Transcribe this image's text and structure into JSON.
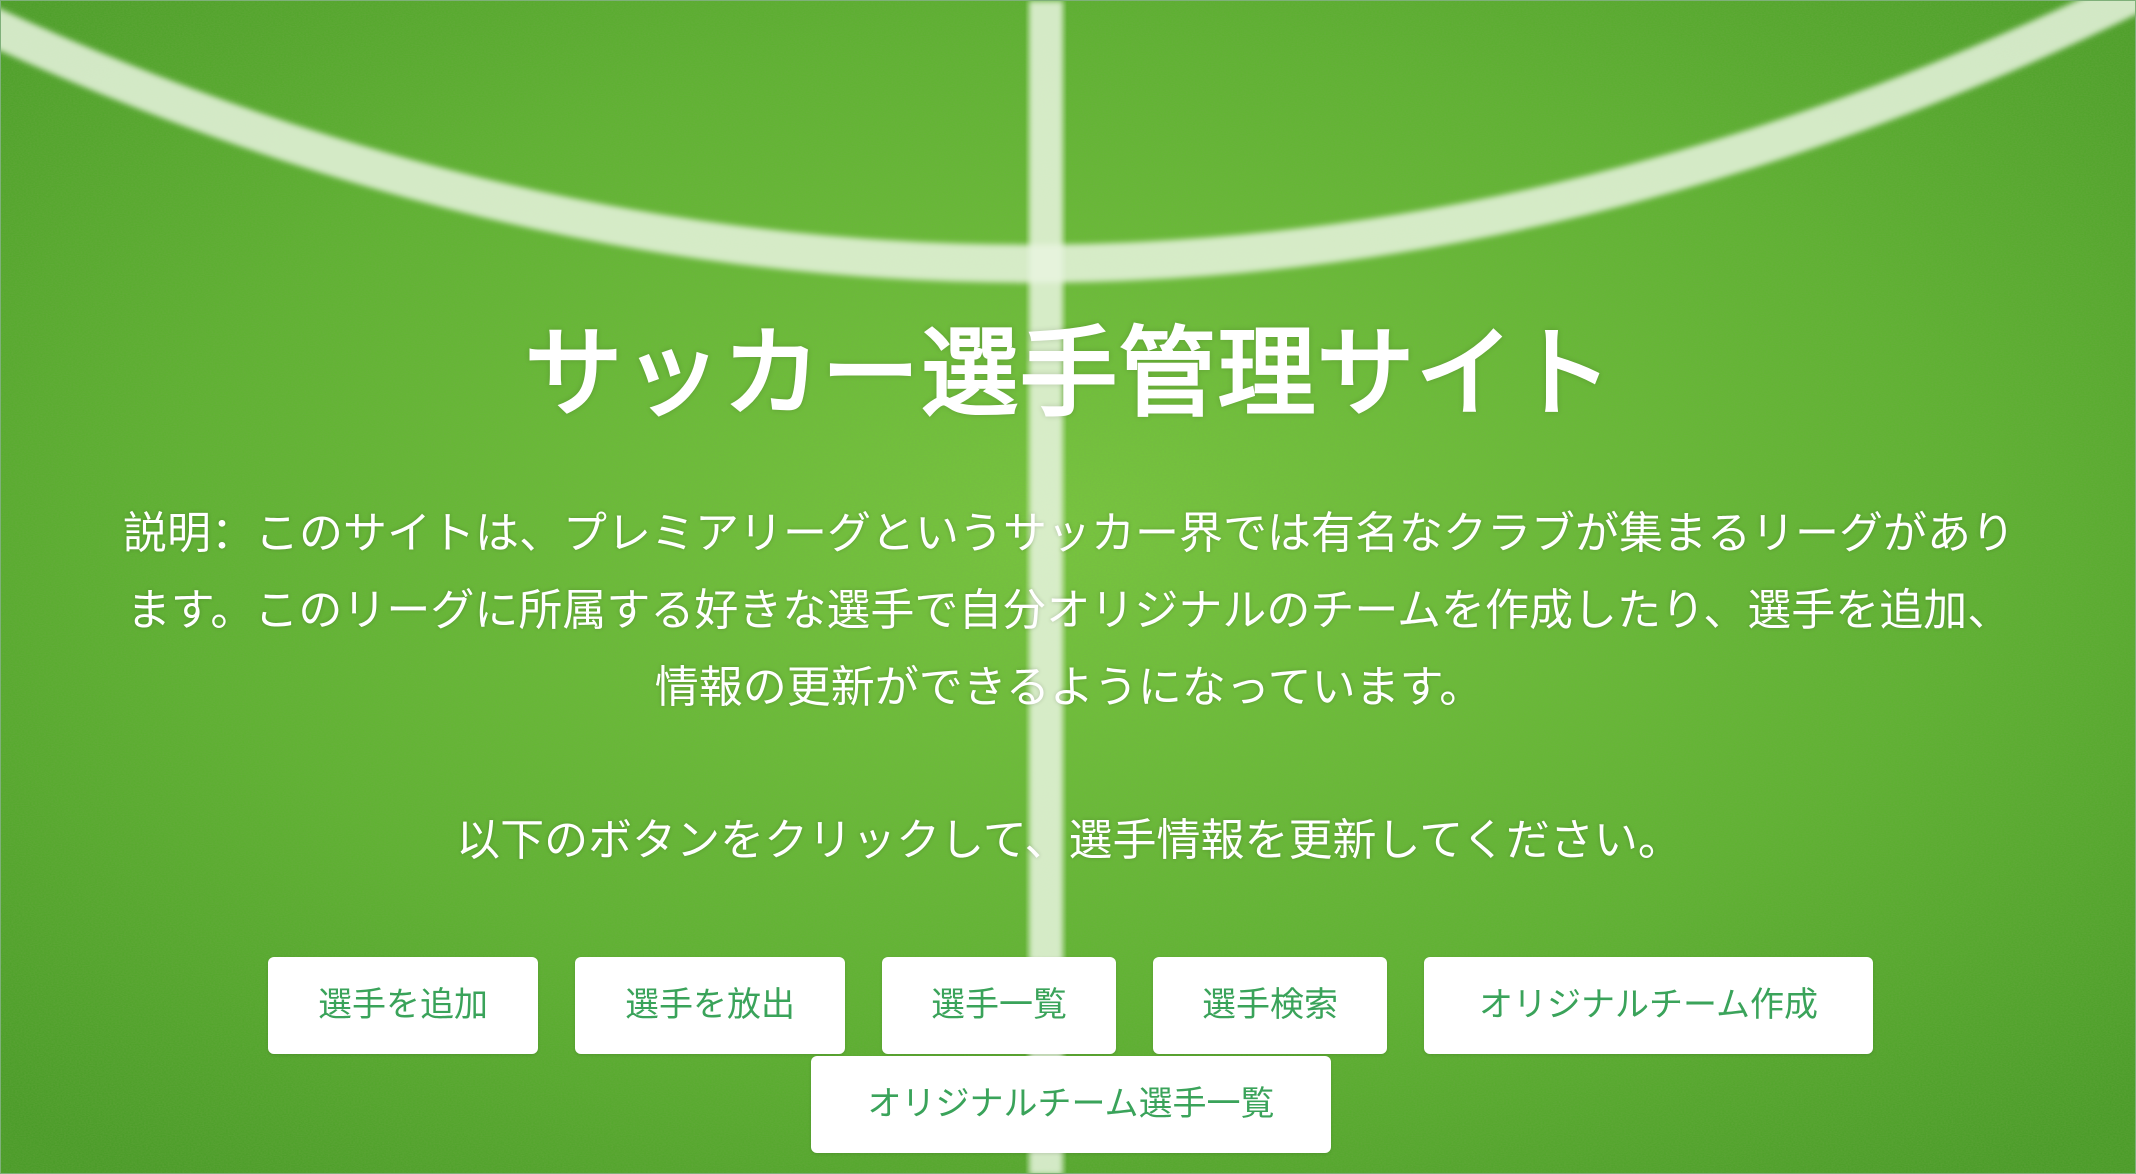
{
  "page": {
    "title": "サッカー選手管理サイト",
    "description_line1": "説明：このサイトは、プレミアリーグというサッカー界では有名なクラブが集まるリーグがあり",
    "description_line2": "ます。このリーグに所属する好きな選手で自分オリジナルのチームを作成したり、選手を追加、",
    "description_line3": "情報の更新ができるようになっています。",
    "instruction": "以下のボタンをクリックして、選手情報を更新してください。"
  },
  "buttons": {
    "add_player": "選手を追加",
    "release_player": "選手を放出",
    "player_list": "選手一覧",
    "player_search": "選手検索",
    "create_original_team": "オリジナルチーム作成",
    "original_team_player_list": "オリジナルチーム選手一覧"
  },
  "colors": {
    "grass": "#5cb030",
    "field_line": "#e6f3dc",
    "button_bg": "#ffffff",
    "button_text": "#3aa35a",
    "text": "#ffffff"
  }
}
